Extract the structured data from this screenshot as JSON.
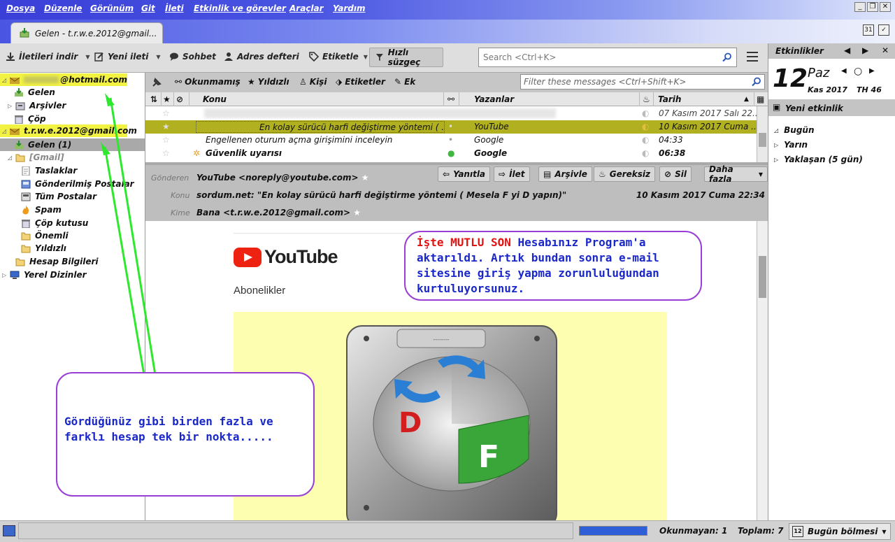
{
  "menu": [
    "Dosya",
    "Düzenle",
    "Görünüm",
    "Git",
    "İleti",
    "Etkinlik ve görevler",
    "Araçlar",
    "Yardım"
  ],
  "tab": {
    "title": "Gelen - t.r.w.e.2012@gmail..."
  },
  "toolbar": {
    "get_messages": "İletileri indir",
    "new_message": "Yeni ileti",
    "chat": "Sohbet",
    "address_book": "Adres defteri",
    "tag": "Etiketle",
    "quick_filter": "Hızlı süzgeç",
    "search_placeholder": "Search <Ctrl+K>"
  },
  "folders": {
    "account1": "@hotmail.com",
    "inbox1": "Gelen",
    "archives1": "Arşivler",
    "trash1": "Çöp",
    "account2": "t.r.w.e.2012@gmail.com",
    "inbox2": "Gelen (1)",
    "gmail": "[Gmail]",
    "drafts": "Taslaklar",
    "sent": "Gönderilmiş Postalar",
    "allmail": "Tüm Postalar",
    "spam": "Spam",
    "trash2": "Çöp kutusu",
    "important": "Önemli",
    "starred": "Yıldızlı",
    "account_info": "Hesap Bilgileri",
    "local": "Yerel Dizinler"
  },
  "list_toolbar": {
    "unread": "Okunmamış",
    "starred": "Yıldızlı",
    "contact": "Kişi",
    "tags": "Etiketler",
    "attachment": "Ek",
    "filter_placeholder": "Filter these messages <Ctrl+Shift+K>"
  },
  "columns": {
    "subject": "Konu",
    "from": "Yazanlar",
    "date": "Tarih"
  },
  "messages": [
    {
      "subject": "",
      "from": "",
      "date": "07 Kasım 2017 Salı 22..."
    },
    {
      "subject": "En kolay sürücü harfi değiştirme yöntemi ( ...",
      "from": "YouTube",
      "date": "10 Kasım 2017 Cuma ..."
    },
    {
      "subject": "Engellenen oturum açma girişimini inceleyin",
      "from": "Google",
      "date": "04:33"
    },
    {
      "subject": "Güvenlik uyarısı",
      "from": "Google",
      "date": "06:38"
    }
  ],
  "header": {
    "from_label": "Gönderen",
    "from": "YouTube <noreply@youtube.com>",
    "subject_label": "Konu",
    "subject": "sordum.net: \"En kolay sürücü harfi değiştirme yöntemi ( Mesela F yi D yapın)\"",
    "date": "10 Kasım 2017 Cuma 22:34",
    "to_label": "Kime",
    "to": "Bana <t.r.w.e.2012@gmail.com>",
    "reply": "Yanıtla",
    "forward": "İlet",
    "archive": "Arşivle",
    "junk": "Gereksiz",
    "delete": "Sil",
    "more": "Daha fazla"
  },
  "email_body": {
    "brand": "YouTube",
    "section": "Abonelikler",
    "drive_letter_old": "D",
    "drive_letter_new": "F",
    "drive_label": "--------"
  },
  "annotations": {
    "bubble1_red": "İşte MUTLU SON",
    "bubble1_text1": " Hesabınız Program'a",
    "bubble1_text2": "aktarıldı. Artık bundan sonra e-mail",
    "bubble1_text3": "sitesine giriş yapma zorunluluğundan",
    "bubble1_text4": "kurtuluyorsunuz.",
    "bubble2_line1": "Gördüğünüz gibi birden fazla ve",
    "bubble2_line2": "farklı hesap tek bir nokta....."
  },
  "calendar": {
    "header": "Etkinlikler",
    "day": "12",
    "weekday": "Paz",
    "month_year": "Kas 2017",
    "week": "TH 46",
    "new_event": "Yeni etkinlik",
    "today": "Bugün",
    "tomorrow": "Yarın",
    "upcoming": "Yaklaşan (5 gün)"
  },
  "status": {
    "unread": "Okunmayan: 1",
    "total": "Toplam: 7",
    "today_pane": "Bugün bölmesi",
    "calendar_day": "12"
  },
  "colors": {
    "highlight": "#f2f243",
    "arrow": "#2ee82e",
    "bubble_border": "#9a3fd6",
    "bubble_text": "#1a27c9",
    "alert_red": "#e21212"
  }
}
